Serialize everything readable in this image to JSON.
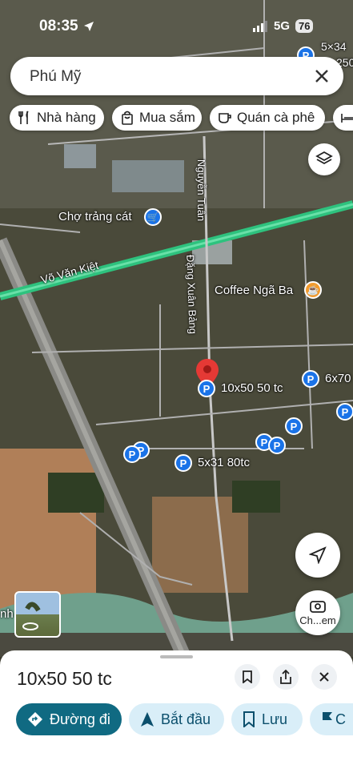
{
  "status": {
    "time": "08:35",
    "network": "5G",
    "battery": "76"
  },
  "search": {
    "query": "Phú Mỹ"
  },
  "chips": [
    {
      "label": "Nhà hàng",
      "icon": "restaurant-icon"
    },
    {
      "label": "Mua sắm",
      "icon": "shopping-bag-icon"
    },
    {
      "label": "Quán cà phê",
      "icon": "coffee-icon"
    }
  ],
  "map": {
    "labels": {
      "market": "Chợ trảng cát",
      "road_vo_van_kiet": "Võ Văn Kiệt",
      "road_nguyen_tuan": "Nguyễn Tuân",
      "road_dang_xuan_bang": "Đặng Xuân Bảng",
      "coffee": "Coffee Ngã Ba",
      "selected_place": "10x50 50 tc",
      "place_5x31": "5x31 80tc",
      "place_6x70": "6x70",
      "place_5x34": "5×34",
      "place_25": "250",
      "street_view_label": "Ch...em",
      "left_edge_text": "nh"
    },
    "pin_letter": "P"
  },
  "sheet": {
    "title": "10x50 50 tc",
    "actions": {
      "directions": "Đường đi",
      "start": "Bắt đầu",
      "save": "Lưu",
      "share_partial": "C"
    }
  },
  "colors": {
    "primary": "#106a82",
    "pin_blue": "#1a73e8",
    "road_green": "#2ec27e",
    "selected_red": "#e53935"
  }
}
